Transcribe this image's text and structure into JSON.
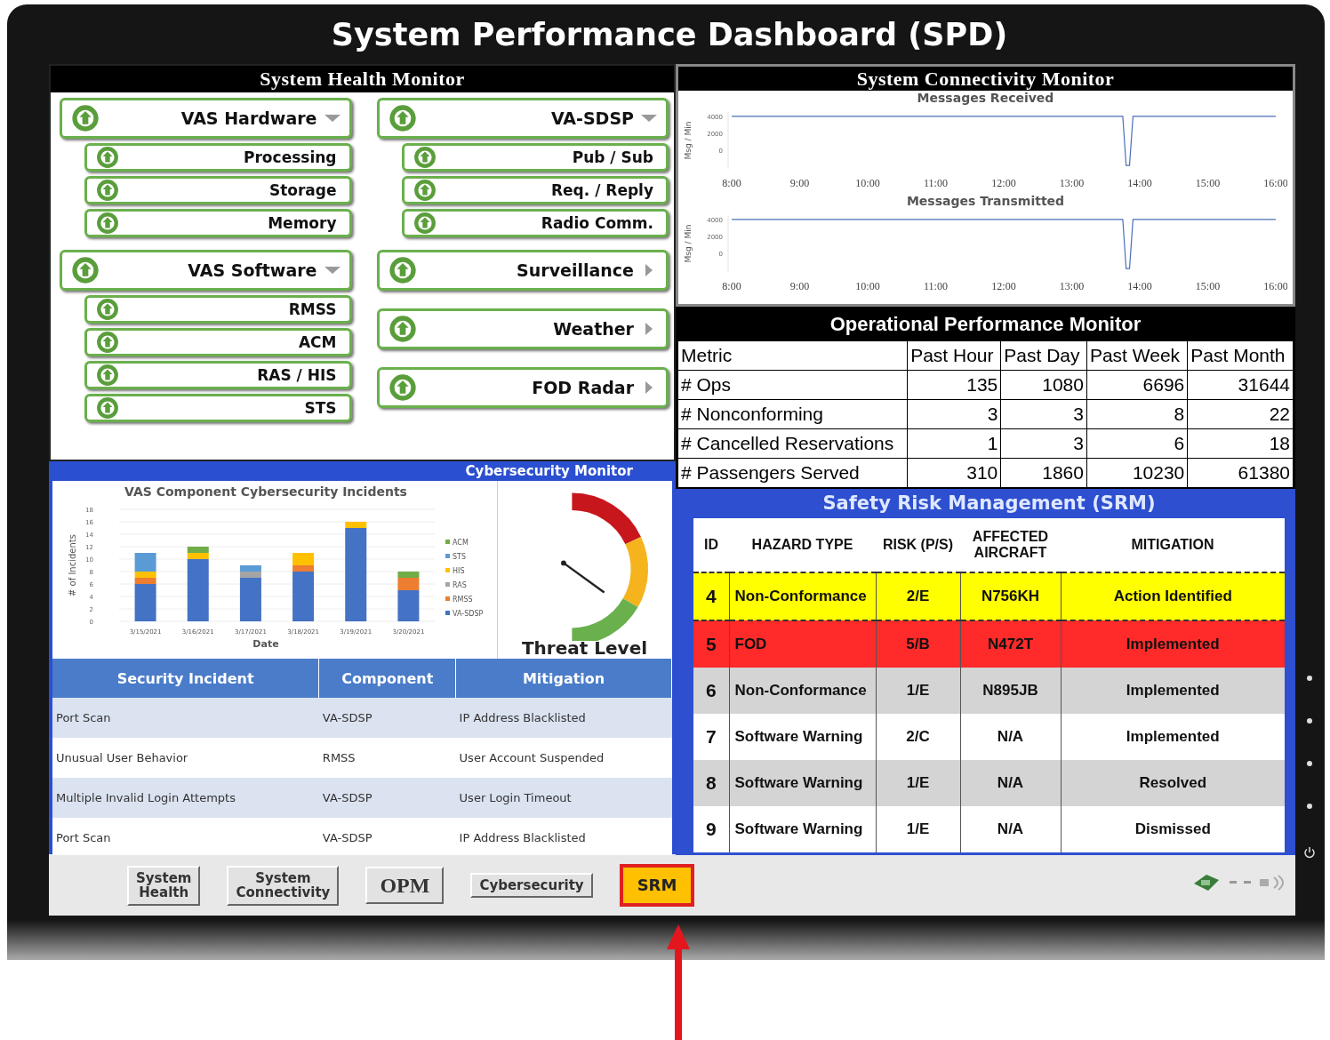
{
  "title": "System Performance Dashboard (SPD)",
  "health": {
    "title": "System Health Monitor",
    "columns": [
      {
        "groups": [
          {
            "label": "VAS Hardware",
            "expanded": true,
            "children": [
              {
                "label": "Processing"
              },
              {
                "label": "Storage"
              },
              {
                "label": "Memory"
              }
            ]
          },
          {
            "label": "VAS Software",
            "expanded": true,
            "children": [
              {
                "label": "RMSS"
              },
              {
                "label": "ACM"
              },
              {
                "label": "RAS / HIS"
              },
              {
                "label": "STS"
              }
            ]
          }
        ]
      },
      {
        "groups": [
          {
            "label": "VA-SDSP",
            "expanded": true,
            "children": [
              {
                "label": "Pub / Sub"
              },
              {
                "label": "Req. / Reply"
              },
              {
                "label": "Radio Comm."
              }
            ]
          },
          {
            "label": "Surveillance",
            "expanded": false
          },
          {
            "label": "Weather",
            "expanded": false
          },
          {
            "label": "FOD Radar",
            "expanded": false
          }
        ]
      }
    ]
  },
  "connectivity": {
    "title": "System Connectivity Monitor",
    "charts": [
      {
        "chart_data": {
          "type": "line",
          "title": "Messages Received",
          "ylabel": "Msg / Min",
          "x": [
            8,
            9,
            10,
            11,
            12,
            13,
            13.75,
            13.8,
            13.85,
            13.9,
            14,
            15,
            16
          ],
          "series": [
            {
              "color": "#4a6fb5",
              "values": [
                4000,
                4000,
                4000,
                4000,
                4000,
                4000,
                4000,
                -1800,
                -1800,
                4000,
                4000,
                4000,
                4000
              ]
            }
          ],
          "ylim": [
            -2200,
            4500
          ],
          "yticks": [
            0,
            2000,
            4000
          ],
          "xlim": [
            8,
            16
          ],
          "xticks": [
            {
              "value": 8,
              "label": "8:00"
            },
            {
              "value": 9,
              "label": "9:00"
            },
            {
              "value": 10,
              "label": "10:00"
            },
            {
              "value": 11,
              "label": "11:00"
            },
            {
              "value": 12,
              "label": "12:00"
            },
            {
              "value": 13,
              "label": "13:00"
            },
            {
              "value": 14,
              "label": "14:00"
            },
            {
              "value": 15,
              "label": "15:00"
            },
            {
              "value": 16,
              "label": "16:00"
            }
          ]
        }
      },
      {
        "chart_data": {
          "type": "line",
          "title": "Messages Transmitted",
          "ylabel": "Msg / Min",
          "x": [
            8,
            9,
            10,
            11,
            12,
            13,
            13.75,
            13.8,
            13.85,
            13.9,
            14,
            15,
            16
          ],
          "series": [
            {
              "color": "#4a6fb5",
              "values": [
                4000,
                4000,
                4000,
                4000,
                4000,
                4000,
                4000,
                -1800,
                -1800,
                4000,
                4000,
                4000,
                4000
              ]
            }
          ],
          "ylim": [
            -2200,
            4500
          ],
          "yticks": [
            0,
            2000,
            4000
          ],
          "xlim": [
            8,
            16
          ],
          "xticks": [
            {
              "value": 8,
              "label": "8:00"
            },
            {
              "value": 9,
              "label": "9:00"
            },
            {
              "value": 10,
              "label": "10:00"
            },
            {
              "value": 11,
              "label": "11:00"
            },
            {
              "value": 12,
              "label": "12:00"
            },
            {
              "value": 13,
              "label": "13:00"
            },
            {
              "value": 14,
              "label": "14:00"
            },
            {
              "value": 15,
              "label": "15:00"
            },
            {
              "value": 16,
              "label": "16:00"
            }
          ]
        }
      }
    ]
  },
  "opm": {
    "title": "Operational Performance Monitor",
    "columns": [
      "Metric",
      "Past Hour",
      "Past Day",
      "Past Week",
      "Past Month"
    ],
    "rows": [
      [
        "# Ops",
        "135",
        "1080",
        "6696",
        "31644"
      ],
      [
        "# Nonconforming",
        "3",
        "3",
        "8",
        "22"
      ],
      [
        "# Cancelled Reservations",
        "1",
        "3",
        "6",
        "18"
      ],
      [
        "# Passengers Served",
        "310",
        "1860",
        "10230",
        "61380"
      ]
    ]
  },
  "cyber": {
    "title": "Cybersecurity Monitor",
    "chart_data": {
      "type": "bar",
      "stacked": true,
      "title": "VAS Component Cybersecurity Incidents",
      "xlabel": "Date",
      "ylabel": "# of Incidents",
      "categories": [
        "3/15/2021",
        "3/16/2021",
        "3/17/2021",
        "3/18/2021",
        "3/19/2021",
        "3/20/2021"
      ],
      "series": [
        {
          "name": "VA-SDSP",
          "color": "#4472c4",
          "values": [
            6,
            10,
            7,
            8,
            15,
            5
          ]
        },
        {
          "name": "RMSS",
          "color": "#ed7d31",
          "values": [
            1,
            0,
            0,
            1,
            0,
            2
          ]
        },
        {
          "name": "RAS",
          "color": "#a5a5a5",
          "values": [
            0,
            0,
            1,
            0,
            0,
            0
          ]
        },
        {
          "name": "HIS",
          "color": "#ffc000",
          "values": [
            1,
            1,
            0,
            2,
            1,
            0
          ]
        },
        {
          "name": "STS",
          "color": "#5b9bd5",
          "values": [
            3,
            0,
            1,
            0,
            0,
            0
          ]
        },
        {
          "name": "ACM",
          "color": "#70ad47",
          "values": [
            0,
            1,
            0,
            0,
            0,
            1
          ]
        }
      ],
      "ylim": [
        0,
        18
      ],
      "yticks": [
        0,
        2,
        4,
        6,
        8,
        10,
        12,
        14,
        16,
        18
      ],
      "grid": true,
      "legend": true
    },
    "threat": {
      "label": "Threat Level"
    },
    "columns": [
      "Security Incident",
      "Component",
      "Mitigation"
    ],
    "rows": [
      [
        "Port Scan",
        "VA-SDSP",
        "IP Address Blacklisted"
      ],
      [
        "Unusual User Behavior",
        "RMSS",
        "User Account Suspended"
      ],
      [
        "Multiple Invalid Login Attempts",
        "VA-SDSP",
        "User Login Timeout"
      ],
      [
        "Port Scan",
        "VA-SDSP",
        "IP Address Blacklisted"
      ]
    ]
  },
  "srm": {
    "title": "Safety Risk Management (SRM)",
    "columns": [
      "ID",
      "HAZARD TYPE",
      "RISK (P/S)",
      "AFFECTED AIRCRAFT",
      "MITIGATION"
    ],
    "rows": [
      {
        "cells": [
          "4",
          "Non-Conformance",
          "2/E",
          "N756KH",
          "Action Identified"
        ],
        "color": "#ffff00"
      },
      {
        "cells": [
          "5",
          "FOD",
          "5/B",
          "N472T",
          "Implemented"
        ],
        "color": "#ff2a2a"
      },
      {
        "cells": [
          "6",
          "Non-Conformance",
          "1/E",
          "N895JB",
          "Implemented"
        ],
        "color": "#d4d4d4"
      },
      {
        "cells": [
          "7",
          "Software Warning",
          "2/C",
          "N/A",
          "Implemented"
        ],
        "color": "#ffffff"
      },
      {
        "cells": [
          "8",
          "Software Warning",
          "1/E",
          "N/A",
          "Resolved"
        ],
        "color": "#d4d4d4"
      },
      {
        "cells": [
          "9",
          "Software Warning",
          "1/E",
          "N/A",
          "Dismissed"
        ],
        "color": "#ffffff"
      }
    ]
  },
  "taskbar": {
    "buttons": [
      {
        "label": "System Health",
        "selected": false
      },
      {
        "label": "System Connectivity",
        "selected": false
      },
      {
        "label": "OPM",
        "selected": false
      },
      {
        "label": "Cybersecurity",
        "selected": false
      },
      {
        "label": "SRM",
        "selected": true
      }
    ]
  }
}
